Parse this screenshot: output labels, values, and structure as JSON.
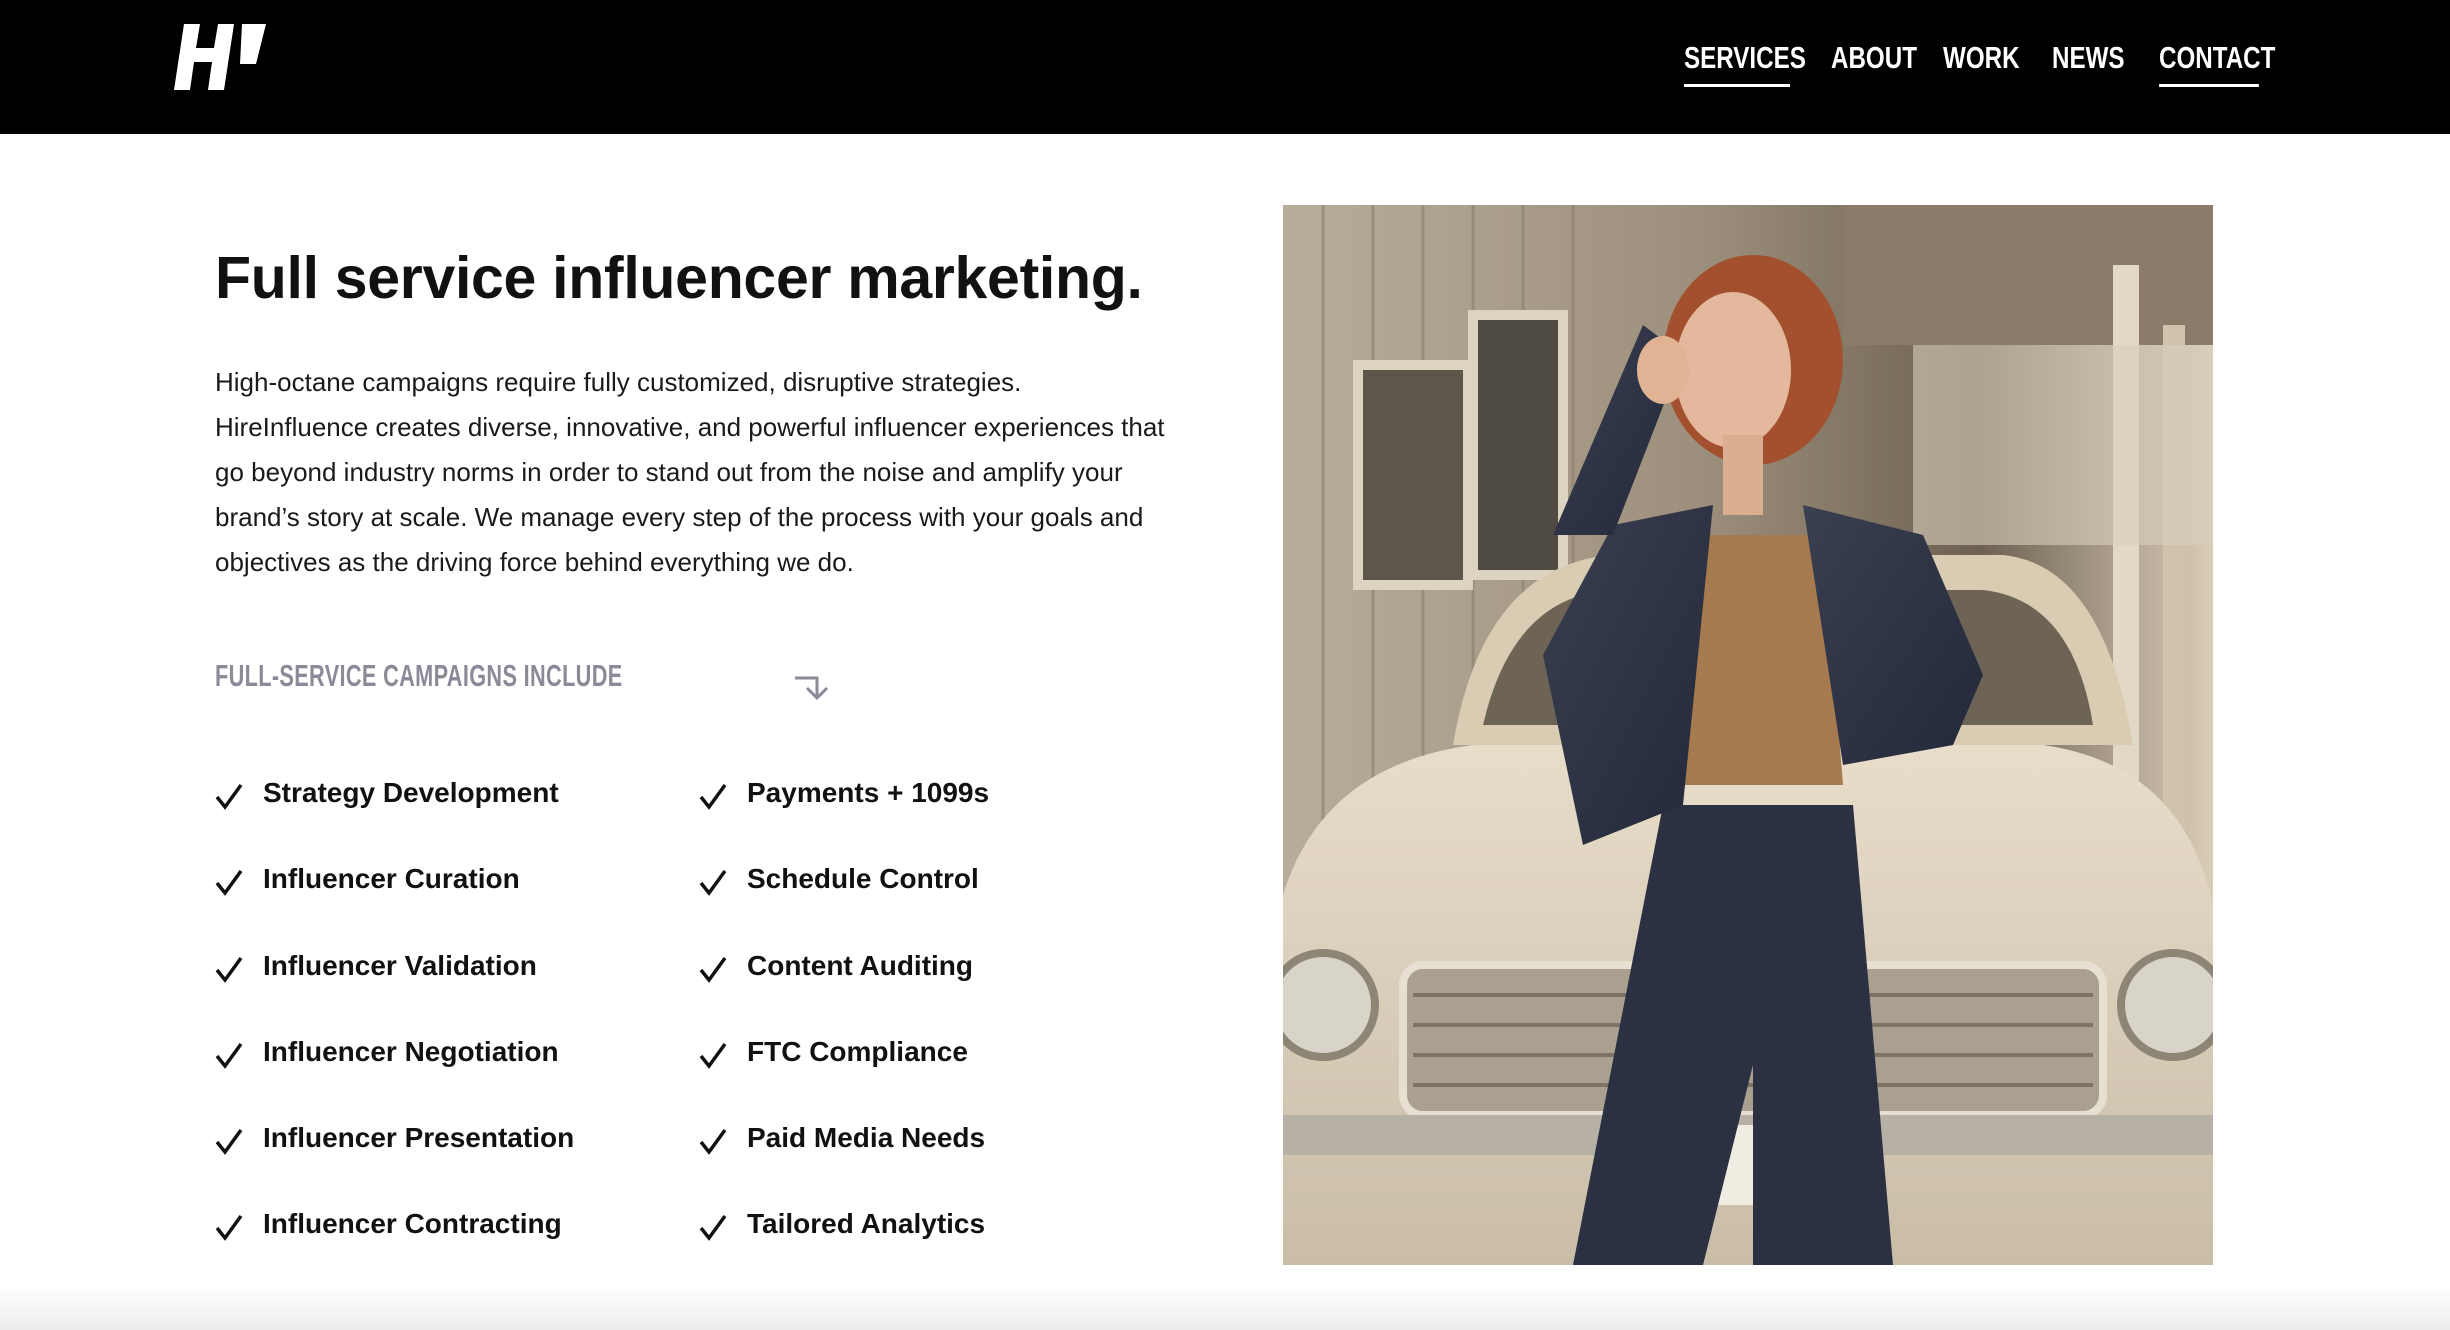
{
  "header": {
    "logo_icon": "hireinfluence-logo",
    "nav": [
      {
        "label": "SERVICES",
        "active": true
      },
      {
        "label": "ABOUT",
        "active": false
      },
      {
        "label": "WORK",
        "active": false
      },
      {
        "label": "NEWS",
        "active": false
      },
      {
        "label": "CONTACT",
        "active": true
      }
    ]
  },
  "main": {
    "headline": "Full service influencer marketing.",
    "body": "High-octane campaigns require fully customized, disruptive strategies. HireInfluence creates diverse, innovative, and powerful influencer experiences that go beyond industry norms in order to stand out from the noise and amplify your brand’s story at scale. We manage every step of the process with your goals and objectives as the driving force behind everything we do.",
    "campaigns_label": "FULL-SERVICE CAMPAIGNS INCLUDE",
    "campaigns_icon": "arrow-down-right-icon",
    "features_left": [
      "Strategy Development",
      "Influencer Curation",
      "Influencer Validation",
      "Influencer Negotiation",
      "Influencer Presentation",
      "Influencer Contracting"
    ],
    "features_right": [
      "Payments + 1099s",
      "Schedule Control",
      "Content Auditing",
      "FTC Compliance",
      "Paid Media Needs",
      "Tailored Analytics"
    ],
    "feature_icon": "checkmark-icon"
  },
  "colors": {
    "header_bg": "#000000",
    "label_gray": "#8a8a98",
    "text": "#111111"
  }
}
